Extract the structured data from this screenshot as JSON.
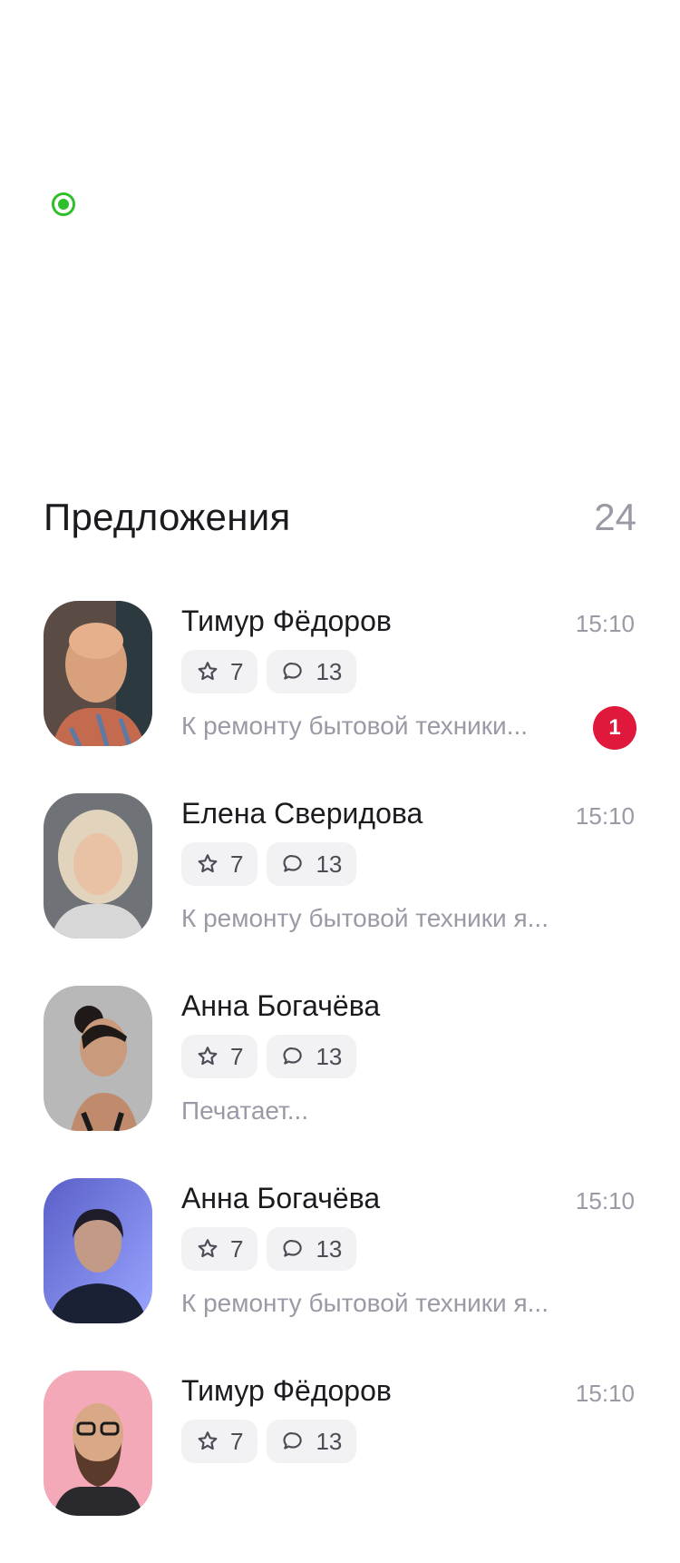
{
  "section": {
    "title": "Предложения",
    "count": "24"
  },
  "offers": [
    {
      "name": "Тимур Фёдоров",
      "time": "15:10",
      "rating": "7",
      "comments": "13",
      "preview": "К ремонту бытовой техники...",
      "unread": "1",
      "avatar": "bald-man"
    },
    {
      "name": "Елена Сверидова",
      "time": "15:10",
      "rating": "7",
      "comments": "13",
      "preview": "К ремонту бытовой техники я...",
      "unread": null,
      "avatar": "older-woman"
    },
    {
      "name": "Анна Богачёва",
      "time": null,
      "rating": "7",
      "comments": "13",
      "preview": "Печатает...",
      "unread": null,
      "avatar": "woman-profile"
    },
    {
      "name": "Анна Богачёва",
      "time": "15:10",
      "rating": "7",
      "comments": "13",
      "preview": "К ремонту бытовой техники я...",
      "unread": null,
      "avatar": "woman-blue"
    },
    {
      "name": "Тимур Фёдоров",
      "time": "15:10",
      "rating": "7",
      "comments": "13",
      "preview": "",
      "unread": null,
      "avatar": "bearded-man"
    }
  ],
  "colors": {
    "accent_green": "#2fbf2a",
    "badge_red": "#e0193c",
    "muted": "#9a9aa6",
    "chip_bg": "#f2f2f5"
  },
  "icons": {
    "rating": "star-icon",
    "comments": "comment-icon",
    "online": "online-indicator-icon"
  }
}
